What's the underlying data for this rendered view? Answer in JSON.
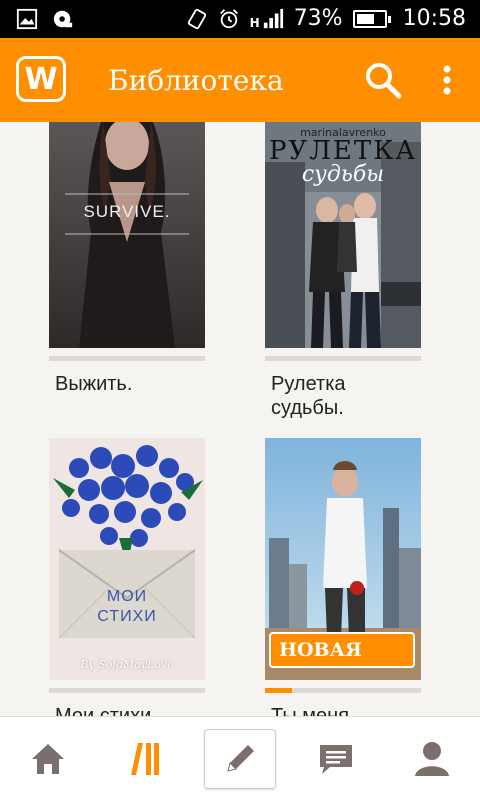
{
  "status_bar": {
    "network": "H",
    "battery_percent": "73%",
    "battery_level": 0.73,
    "time": "10:58",
    "icons": [
      "image-icon",
      "podcast-icon",
      "rotate-icon",
      "alarm-icon",
      "signal-icon",
      "battery-icon"
    ]
  },
  "app_bar": {
    "logo": "W",
    "title": "Библиотека",
    "icons": [
      "search-icon",
      "more-vert-icon"
    ]
  },
  "books": [
    {
      "title": "Выжить.",
      "cover_text": "SURVIVE.",
      "progress": 0
    },
    {
      "title": "Рулетка судьбы.",
      "cover_author": "marinalavrenko",
      "cover_title": "Рулетка",
      "cover_subtitle": "судьбы",
      "progress": 0
    },
    {
      "title": "Мои стихи",
      "cover_title_line1": "мои",
      "cover_title_line2": "стихи",
      "cover_author": "By SofaMayLove",
      "progress": 0
    },
    {
      "title": "Ты меня",
      "badge": "НОВАЯ",
      "progress": 0.17
    }
  ],
  "bottom_nav": {
    "items": [
      "home-icon",
      "library-icon",
      "write-icon",
      "messages-icon",
      "profile-icon"
    ],
    "active": "library-icon"
  },
  "colors": {
    "accent": "#ff8f00",
    "background": "#f6f4f1",
    "nav_icon": "#7a6f6a"
  }
}
